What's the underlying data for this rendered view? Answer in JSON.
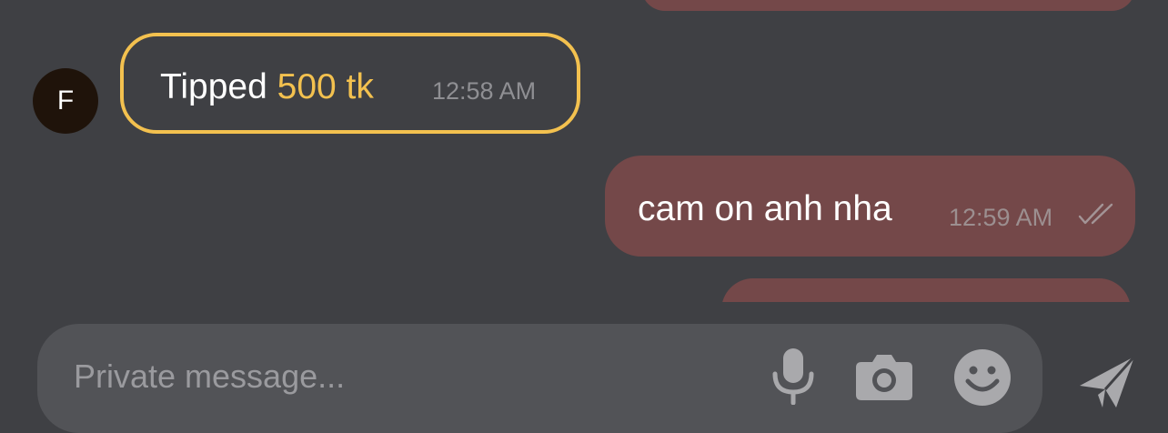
{
  "colors": {
    "background": "#3f4044",
    "outgoing_bubble": "#744849",
    "tip_accent": "#f3c14f",
    "composer": "#525357",
    "icon_gray": "#a9a9ac"
  },
  "messages": {
    "tip": {
      "avatar_letter": "F",
      "label": "Tipped",
      "amount": "500 tk",
      "time": "12:58 AM"
    },
    "outgoing": {
      "text": "cam on anh nha",
      "time": "12:59 AM",
      "status_icon": "double-check-icon"
    }
  },
  "composer": {
    "placeholder": "Private message...",
    "value": "",
    "icons": [
      "microphone-icon",
      "camera-icon",
      "emoji-icon",
      "send-icon"
    ]
  }
}
